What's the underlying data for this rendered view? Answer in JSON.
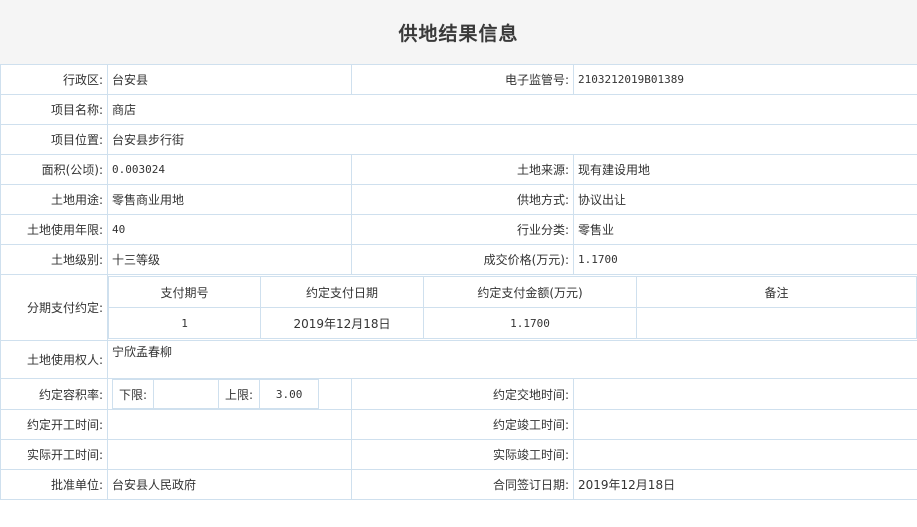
{
  "title": "供地结果信息",
  "fields": {
    "district": {
      "label": "行政区:",
      "value": "台安县"
    },
    "supervision_no": {
      "label": "电子监管号:",
      "value": "2103212019B01389"
    },
    "project_name": {
      "label": "项目名称:",
      "value": "商店"
    },
    "project_location": {
      "label": "项目位置:",
      "value": "台安县步行街"
    },
    "area": {
      "label": "面积(公顷):",
      "value": "0.003024"
    },
    "land_source": {
      "label": "土地来源:",
      "value": "现有建设用地"
    },
    "land_use": {
      "label": "土地用途:",
      "value": "零售商业用地"
    },
    "supply_method": {
      "label": "供地方式:",
      "value": "协议出让"
    },
    "use_years": {
      "label": "土地使用年限:",
      "value": "40"
    },
    "industry": {
      "label": "行业分类:",
      "value": "零售业"
    },
    "land_grade": {
      "label": "土地级别:",
      "value": "十三等级"
    },
    "price": {
      "label": "成交价格(万元):",
      "value": "1.1700"
    },
    "installments": {
      "label": "分期支付约定:",
      "headers": [
        "支付期号",
        "约定支付日期",
        "约定支付金额(万元)",
        "备注"
      ],
      "rows": [
        [
          "1",
          "2019年12月18日",
          "1.1700",
          ""
        ]
      ]
    },
    "land_user": {
      "label": "土地使用权人:",
      "value": "宁欣孟春柳"
    },
    "plot_ratio": {
      "label": "约定容积率:",
      "lower_label": "下限:",
      "lower_value": "",
      "upper_label": "上限:",
      "upper_value": "3.00"
    },
    "handover_time": {
      "label": "约定交地时间:",
      "value": ""
    },
    "start_time": {
      "label": "约定开工时间:",
      "value": ""
    },
    "completion_time": {
      "label": "约定竣工时间:",
      "value": ""
    },
    "actual_start": {
      "label": "实际开工时间:",
      "value": ""
    },
    "actual_completion": {
      "label": "实际竣工时间:",
      "value": ""
    },
    "approver": {
      "label": "批准单位:",
      "value": "台安县人民政府"
    },
    "contract_date": {
      "label": "合同签订日期:",
      "value": "2019年12月18日"
    }
  }
}
